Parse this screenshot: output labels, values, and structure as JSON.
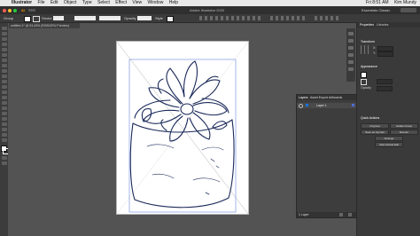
{
  "menubar": {
    "app_name": "Illustrator",
    "items": [
      "File",
      "Edit",
      "Object",
      "Type",
      "Select",
      "Effect",
      "View",
      "Window",
      "Help"
    ],
    "clock": "Fri 8:51 AM",
    "user": "Kim Mundy"
  },
  "appbar": {
    "app_badge": "Ai",
    "title": "Adobe Illustrator 2020",
    "workspace": "Essentials Classic"
  },
  "controlbar": {
    "selection_label": "Group",
    "stroke_label": "Stroke",
    "opacity_label": "Opacity",
    "style_label": "Style"
  },
  "doc_tab": {
    "label": "untitled-1* @ 53.43% (RGB/GPU Preview)"
  },
  "properties_panel": {
    "tabs": [
      "Properties",
      "Libraries"
    ],
    "section_transform": "Transform",
    "x_label": "X:",
    "x_value": "",
    "y_label": "Y:",
    "y_value": "",
    "section_appearance": "Appearance",
    "opacity_label": "Opacity",
    "section_quick_actions": "Quick Actions",
    "buttons": [
      "Ungroup",
      "Isolate Group",
      "Save as Symbol",
      "Recolor",
      "Arrange",
      "Start Global Edit"
    ]
  },
  "layers_panel": {
    "tabs": [
      "Layers",
      "Asset Export",
      "Artboards"
    ],
    "layer_name": "Layer 1",
    "footer_count": "1 Layer"
  },
  "colors": {
    "panel_dark": "#3a3a3a",
    "canvas": "#535353",
    "accent_blue": "#1473e6",
    "selection_blue": "#4a6fd8"
  }
}
